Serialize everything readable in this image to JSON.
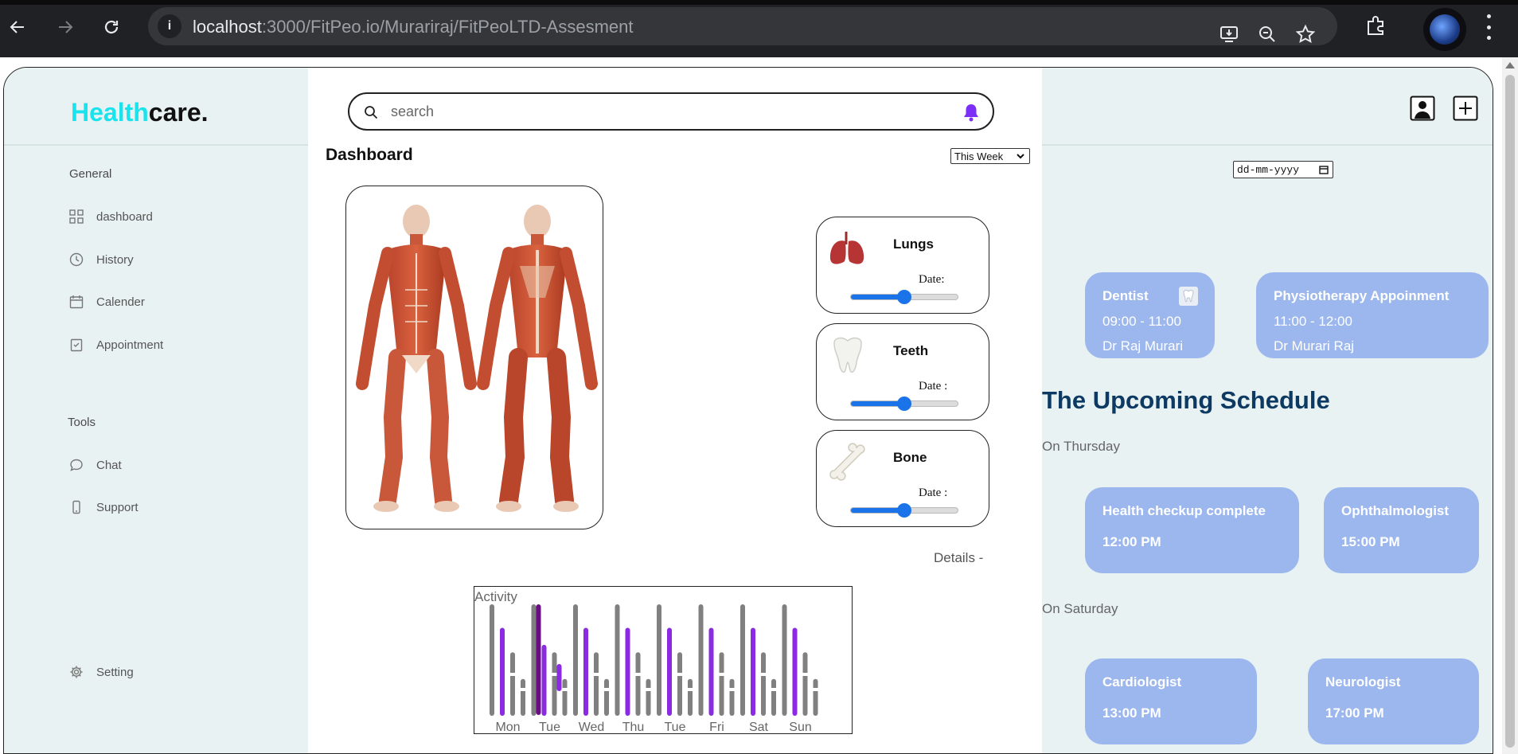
{
  "browser": {
    "url_host": "localhost",
    "url_rest": ":3000/FitPeo.io/Murariraj/FitPeoLTD-Assesment"
  },
  "sidebar": {
    "logo_accent": "Health",
    "logo_rest": "care.",
    "general_label": "General",
    "items": [
      {
        "label": "dashboard",
        "icon": "grid-icon"
      },
      {
        "label": "History",
        "icon": "clock-icon"
      },
      {
        "label": "Calender",
        "icon": "calendar-icon"
      },
      {
        "label": "Appointment",
        "icon": "clipboard-icon"
      }
    ],
    "tools_label": "Tools",
    "tools": [
      {
        "label": "Chat",
        "icon": "chat-icon"
      },
      {
        "label": "Support",
        "icon": "phone-icon"
      }
    ],
    "setting_label": "Setting"
  },
  "main": {
    "search_placeholder": "search",
    "title": "Dashboard",
    "period": "This Week",
    "organs": [
      {
        "name": "Lungs",
        "date_label": "Date:",
        "value": 0.5,
        "icon": "lungs-icon"
      },
      {
        "name": "Teeth",
        "date_label": "Date :",
        "value": 0.5,
        "icon": "tooth-icon"
      },
      {
        "name": "Bone",
        "date_label": "Date :",
        "value": 0.5,
        "icon": "bone-icon"
      }
    ],
    "details_link": "Details -"
  },
  "chart_data": {
    "type": "bar",
    "title": "Activity",
    "categories": [
      "Mon",
      "Tue",
      "Wed",
      "Thu",
      "Tue",
      "Fri",
      "Sat",
      "Sun"
    ],
    "series": [
      {
        "color": "#808080",
        "values": [
          1.0,
          1.0,
          1.0,
          1.0,
          1.0,
          1.0,
          1.0,
          1.0
        ]
      },
      {
        "color": "#8a2be2",
        "values": [
          0.78,
          0.62,
          0.78,
          0.78,
          0.78,
          0.78,
          0.78,
          0.78
        ]
      },
      {
        "color": "#808080",
        "values": [
          0.55,
          0.55,
          0.55,
          0.55,
          0.55,
          0.55,
          0.55,
          0.55
        ]
      },
      {
        "color": "#808080",
        "values": [
          0.3,
          0.3,
          0.3,
          0.3,
          0.3,
          0.3,
          0.3,
          0.3
        ]
      }
    ],
    "accent_color": "#8a2be2",
    "dark_accent_color": "#6a0d83"
  },
  "right": {
    "date_placeholder": "dd-mm-yyyy",
    "top_appointments": [
      {
        "title": "Dentist",
        "time": "09:00 - 11:00",
        "doctor": "Dr Raj Murari"
      },
      {
        "title": "Physiotherapy Appoinment",
        "time": "11:00 - 12:00",
        "doctor": "Dr Murari Raj"
      }
    ],
    "upcoming_title": "The Upcoming Schedule",
    "days": [
      {
        "label": "On Thursday",
        "items": [
          {
            "title": "Health checkup complete",
            "time": "12:00 PM"
          },
          {
            "title": "Ophthalmologist",
            "time": "15:00 PM"
          }
        ]
      },
      {
        "label": "On Saturday",
        "items": [
          {
            "title": "Cardiologist",
            "time": "13:00 PM"
          },
          {
            "title": "Neurologist",
            "time": "17:00 PM"
          }
        ]
      }
    ]
  }
}
